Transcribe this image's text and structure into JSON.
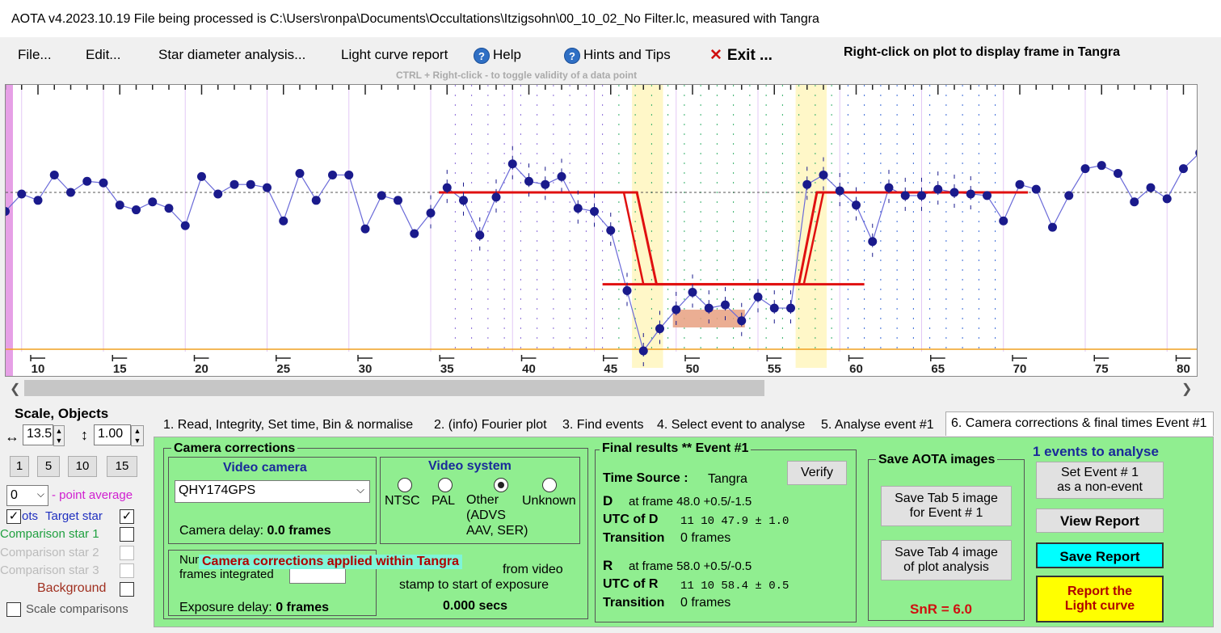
{
  "window": {
    "title": "AOTA v4.2023.10.19    File being processed is C:\\Users\\ronpa\\Documents\\Occultations\\Itzigsohn\\00_10_02_No Filter.lc, measured with Tangra"
  },
  "menu": {
    "file": "File...",
    "edit": "Edit...",
    "star_diameter": "Star diameter analysis...",
    "light_curve_report": "Light curve report",
    "help": "Help",
    "hints": "Hints and Tips",
    "exit": "Exit ...",
    "right_click_note": "Right-click on plot to display frame in Tangra",
    "ctrl_note": "CTRL + Right-click  -  to toggle validity of a data point"
  },
  "chart_data": {
    "type": "line",
    "x_ticks": [
      10,
      15,
      20,
      25,
      30,
      35,
      40,
      45,
      50,
      55,
      60,
      65,
      70,
      75,
      80
    ],
    "xlim": [
      8,
      80.5
    ],
    "ylim": [
      0,
      1.3
    ],
    "baseline_level": 1.0,
    "event_level": 0.42,
    "zero_level": 0.0,
    "series": [
      {
        "x": [
          8,
          9,
          10,
          11,
          12,
          13,
          14,
          15,
          16,
          17,
          18,
          19,
          20,
          21,
          22,
          23,
          24,
          25,
          26,
          27,
          28,
          29,
          30,
          31,
          32,
          33,
          34,
          35,
          36,
          37,
          38,
          39,
          40,
          41,
          42,
          43,
          44,
          45,
          46,
          47,
          48,
          49,
          50,
          51,
          52,
          53,
          54,
          55,
          56,
          57,
          58,
          59,
          60,
          61,
          62,
          63,
          64,
          65,
          66,
          67,
          68,
          69,
          70,
          71,
          72,
          73,
          74,
          75,
          76,
          77,
          78,
          79,
          80,
          81
        ],
        "y": [
          0.88,
          0.99,
          0.95,
          1.11,
          1.0,
          1.07,
          1.06,
          0.92,
          0.89,
          0.94,
          0.9,
          0.79,
          1.1,
          0.99,
          1.05,
          1.05,
          1.03,
          0.82,
          1.12,
          0.95,
          1.11,
          1.11,
          0.77,
          0.98,
          0.95,
          0.74,
          0.87,
          1.03,
          0.95,
          0.73,
          0.97,
          1.18,
          1.07,
          1.05,
          1.1,
          0.9,
          0.88,
          0.76,
          0.38,
          0.0,
          0.14,
          0.26,
          0.37,
          0.27,
          0.29,
          0.19,
          0.34,
          0.27,
          0.27,
          1.05,
          1.11,
          1.01,
          0.92,
          0.69,
          1.03,
          0.98,
          0.98,
          1.02,
          1.0,
          0.99,
          0.98,
          0.82,
          1.05,
          1.02,
          0.78,
          0.98,
          1.15,
          1.17,
          1.12,
          0.94,
          1.03,
          0.96,
          1.15,
          1.25
        ]
      }
    ],
    "event_d_frame": 48.0,
    "event_r_frame": 58.0
  },
  "left_panel": {
    "scale_objects": "Scale,  Objects",
    "scale_value": "13.5",
    "scale_value2": "1.00",
    "buttons": [
      "1",
      "5",
      "10",
      "15"
    ],
    "point_avg_value": "0",
    "point_avg_label": "- point average",
    "dots": "ots",
    "target_star": "Target star",
    "comparison1": "Comparison star 1",
    "comparison2": "Comparison star 2",
    "comparison3": "Comparison star 3",
    "background": "Background",
    "scale_comparisons": "Scale comparisons"
  },
  "tabs": [
    "1.  Read, Integrity, Set time, Bin & normalise",
    "2. (info)  Fourier plot",
    "3. Find events",
    "4. Select event to analyse",
    "5. Analyse event #1",
    "6. Camera corrections & final times Event #1"
  ],
  "camera": {
    "group_title": "Camera corrections",
    "video_camera": "Video camera",
    "camera_select": "QHY174GPS",
    "camera_delay_label": "Camera delay: ",
    "camera_delay_value": "0.0 frames",
    "video_system": "Video system",
    "ntsc": "NTSC",
    "pal": "PAL",
    "other": "Other\n(ADVS\nAAV, SER)",
    "unknown": "Unknown",
    "num_frames_label": "Num\nframes integrated",
    "overlay": "Camera corrections applied within Tangra",
    "from_video": "from video",
    "stamp_to_start": "stamp to start of exposure",
    "secs": "0.000 secs",
    "exposure_delay_label": "Exposure delay: ",
    "exposure_delay_value": "0 frames"
  },
  "final": {
    "title": "Final results  **  Event #1",
    "time_source_label": "Time Source :",
    "time_source_value": "Tangra",
    "verify": "Verify",
    "d_label": "D",
    "d_frame": "at frame 48.0  +0.5/-1.5",
    "utc_d_label": "UTC of D",
    "utc_d_value": "11 10 47.9    ± 1.0",
    "transition_label": "Transition",
    "transition_d": "0 frames",
    "r_label": "R",
    "r_frame": "at frame 58.0  +0.5/-0.5",
    "utc_r_label": "UTC of R",
    "utc_r_value": "11 10 58.4    ± 0.5",
    "transition_r": "0 frames"
  },
  "save_images": {
    "title": "Save AOTA images",
    "tab5": "Save Tab 5 image\nfor Event # 1",
    "tab4": "Save Tab 4 image\nof plot analysis",
    "snr": "SnR = 6.0"
  },
  "right": {
    "events_to_analyse": "1  events to analyse",
    "set_event": "Set Event # 1\nas a non-event",
    "view_report": "View Report",
    "save_report": "Save Report",
    "report_lc": "Report the\nLight curve"
  },
  "colors": {
    "fit_line": "#e01010",
    "data_points": "#1a1a8c",
    "plot_line": "#6a6ad8",
    "event_band": "#fff7c8",
    "panel_green": "#90ee90",
    "save_report_cyan": "#00ffff",
    "report_yellow": "#ffff00"
  }
}
